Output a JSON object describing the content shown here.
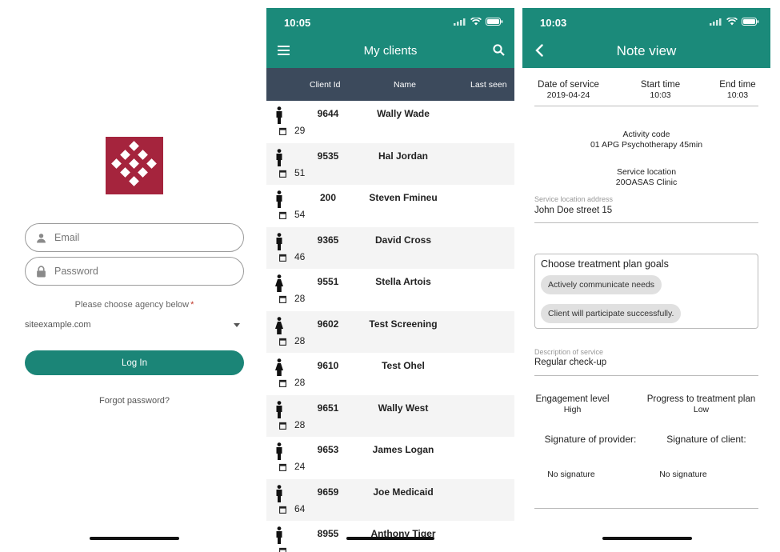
{
  "login": {
    "email_placeholder": "Email",
    "password_placeholder": "Password",
    "agency_label": "Please choose agency below",
    "agency_required_mark": "*",
    "agency_value": "siteexample.com",
    "login_label": "Log In",
    "forgot_label": "Forgot password?",
    "brand_color": "#a5243d",
    "accent_color": "#1b8577"
  },
  "clients": {
    "status_time": "10:05",
    "title": "My clients",
    "columns": [
      "Client Id",
      "Name",
      "Last seen"
    ],
    "rows": [
      {
        "id": "9644",
        "name": "Wally Wade",
        "days": "29",
        "gender": "male"
      },
      {
        "id": "9535",
        "name": "Hal Jordan",
        "days": "51",
        "gender": "male"
      },
      {
        "id": "200",
        "name": "Steven Fmineu",
        "days": "54",
        "gender": "male"
      },
      {
        "id": "9365",
        "name": "David Cross",
        "days": "46",
        "gender": "male"
      },
      {
        "id": "9551",
        "name": "Stella Artois",
        "days": "28",
        "gender": "female"
      },
      {
        "id": "9602",
        "name": "Test Screening",
        "days": "28",
        "gender": "female"
      },
      {
        "id": "9610",
        "name": "Test Ohel",
        "days": "28",
        "gender": "female"
      },
      {
        "id": "9651",
        "name": "Wally West",
        "days": "28",
        "gender": "male"
      },
      {
        "id": "9653",
        "name": "James Logan",
        "days": "24",
        "gender": "male"
      },
      {
        "id": "9659",
        "name": "Joe Medicaid",
        "days": "64",
        "gender": "male"
      },
      {
        "id": "8955",
        "name": "Anthony Tiger",
        "days": "",
        "gender": "male"
      }
    ],
    "header_color": "#1b8a7a",
    "table_header_color": "#3c4a5c"
  },
  "note": {
    "status_time": "10:03",
    "title": "Note view",
    "date_label": "Date of service",
    "date_value": "2019-04-24",
    "start_label": "Start time",
    "start_value": "10:03",
    "end_label": "End time",
    "end_value": "10:03",
    "activity_label": "Activity code",
    "activity_value": "01 APG Psychotherapy 45min",
    "location_label": "Service location",
    "location_value": "20OASAS Clinic",
    "address_label": "Service location address",
    "address_value": "John Doe street 15",
    "goals_label": "Choose treatment plan goals",
    "goals": [
      "Actively communicate needs",
      "Client will participate successfully."
    ],
    "description_label": "Description of service",
    "description_value": "Regular check-up",
    "engagement_label": "Engagement level",
    "engagement_value": "High",
    "progress_label": "Progress to treatment plan",
    "progress_value": "Low",
    "sig_provider_label": "Signature of provider:",
    "sig_client_label": "Signature of client:",
    "sig_provider_value": "No signature",
    "sig_client_value": "No signature"
  }
}
